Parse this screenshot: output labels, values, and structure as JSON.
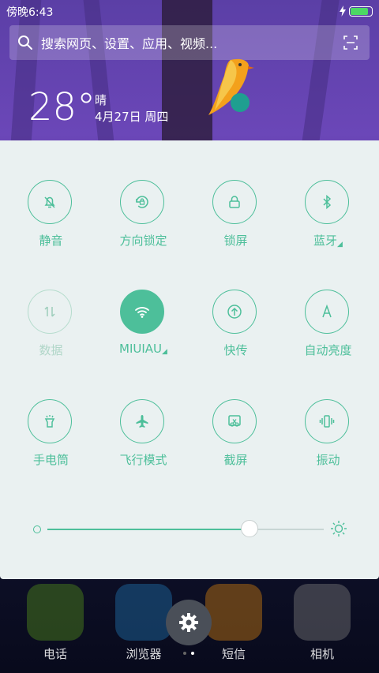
{
  "status": {
    "time": "傍晚6:43",
    "battery_color": "#4cd964"
  },
  "search": {
    "placeholder": "搜索网页、设置、应用、视频..."
  },
  "weather": {
    "temp": "28°",
    "condition": "晴",
    "date": "4月27日 周四"
  },
  "toggles": [
    {
      "label": "静音",
      "icon": "bell-off-icon",
      "state": "off"
    },
    {
      "label": "方向锁定",
      "icon": "rotation-lock-icon",
      "state": "off"
    },
    {
      "label": "锁屏",
      "icon": "lock-icon",
      "state": "off"
    },
    {
      "label": "蓝牙",
      "icon": "bluetooth-icon",
      "state": "off",
      "has_more": true
    },
    {
      "label": "数据",
      "icon": "mobile-data-icon",
      "state": "disabled"
    },
    {
      "label": "MIUIAU",
      "icon": "wifi-icon",
      "state": "on",
      "has_more": true
    },
    {
      "label": "快传",
      "icon": "quick-transfer-icon",
      "state": "off"
    },
    {
      "label": "自动亮度",
      "icon": "auto-brightness-icon",
      "state": "off"
    },
    {
      "label": "手电筒",
      "icon": "flashlight-icon",
      "state": "off"
    },
    {
      "label": "飞行模式",
      "icon": "airplane-icon",
      "state": "off"
    },
    {
      "label": "截屏",
      "icon": "screenshot-icon",
      "state": "off"
    },
    {
      "label": "振动",
      "icon": "vibrate-icon",
      "state": "off"
    }
  ],
  "brightness": {
    "level": 0.73
  },
  "accent_color": "#4dbf9a",
  "dock": [
    {
      "label": "电话",
      "icon": "phone-icon",
      "color": "#4f8a1a"
    },
    {
      "label": "浏览器",
      "icon": "browser-icon",
      "color": "#1e6fa8"
    },
    {
      "label": "短信",
      "icon": "messages-icon",
      "color": "#c97a10"
    },
    {
      "label": "相机",
      "icon": "camera-icon",
      "color": "#777777"
    }
  ]
}
